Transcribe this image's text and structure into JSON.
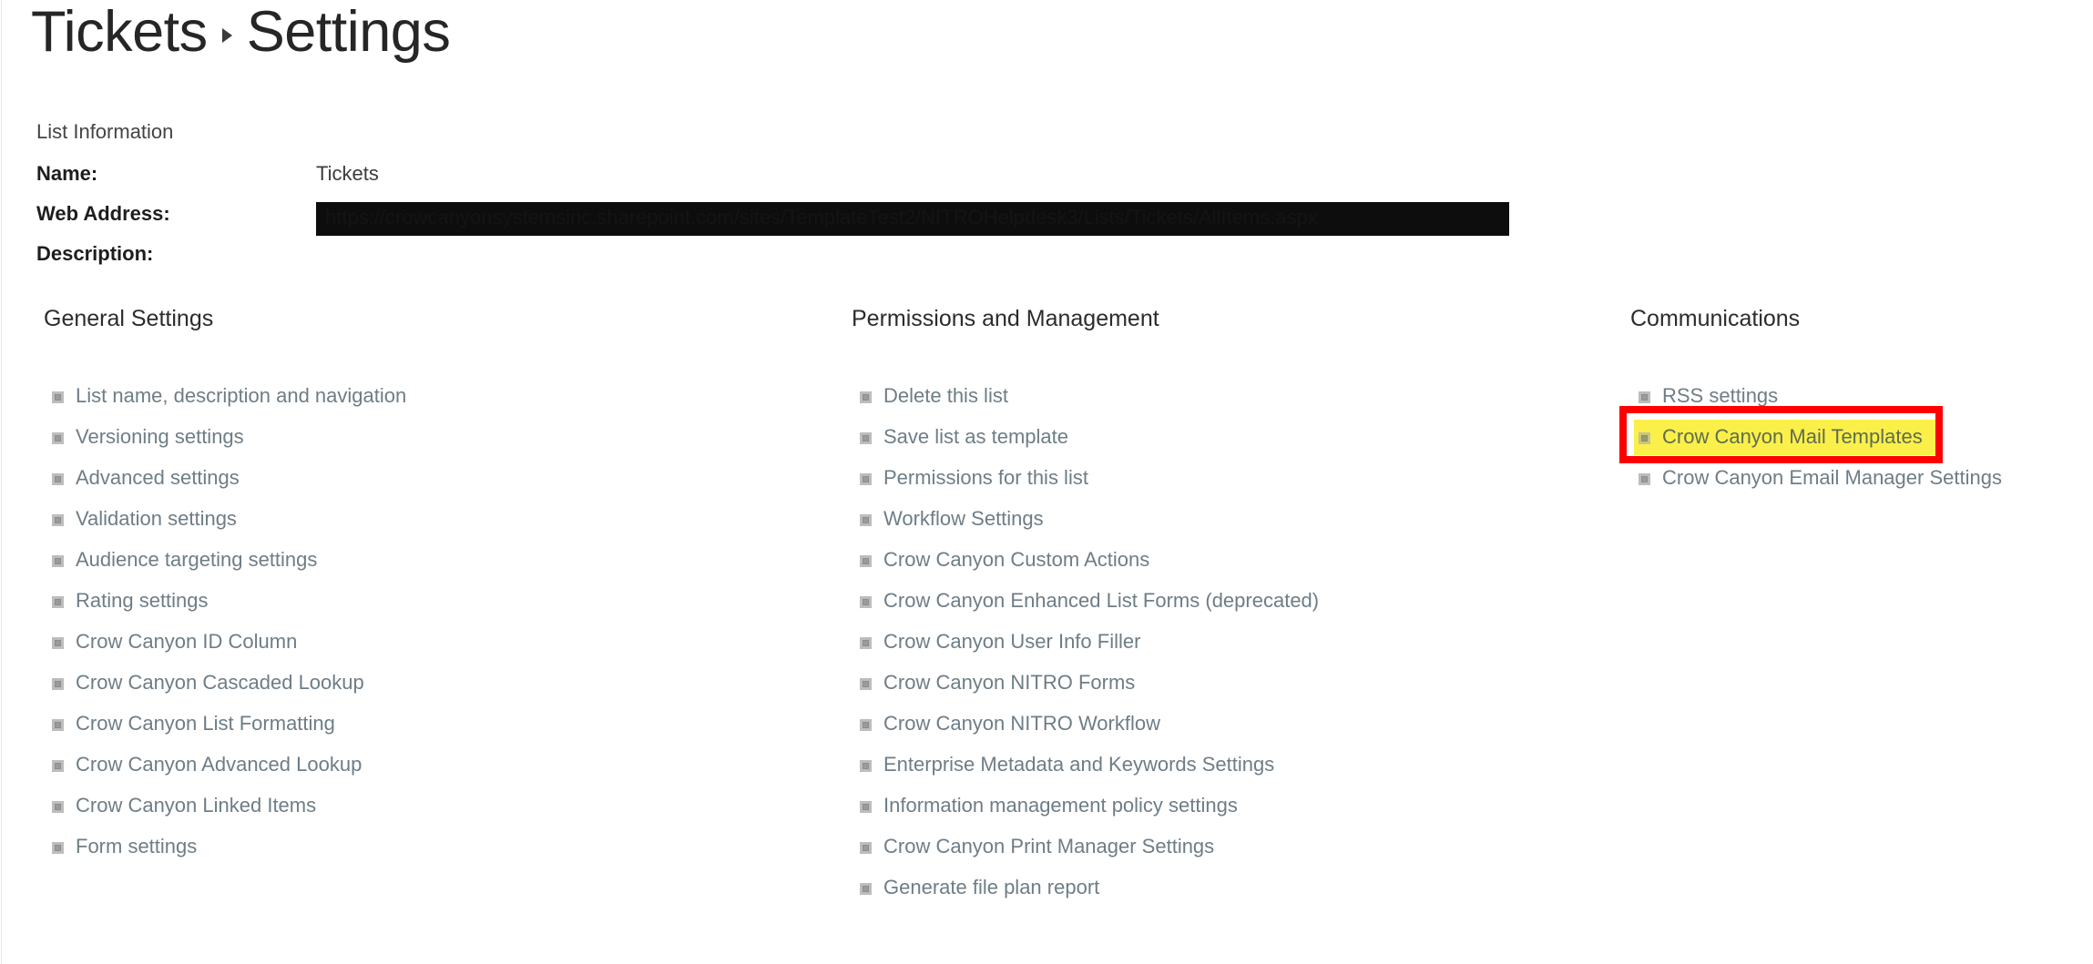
{
  "breadcrumb": {
    "parent": "Tickets",
    "separator_icon": "caret-right-icon",
    "current": "Settings"
  },
  "list_information": {
    "heading": "List Information",
    "fields": [
      {
        "label": "Name:",
        "value": "Tickets"
      },
      {
        "label": "Web Address:",
        "value": "https://crowcanyonsystemsinc.sharepoint.com/sites/TemplateTest2/NITROHelpdesk3/Lists/Tickets/AllItems.aspx"
      },
      {
        "label": "Description:",
        "value": ""
      }
    ]
  },
  "columns": {
    "general": {
      "heading": "General Settings",
      "links": [
        "List name, description and navigation",
        "Versioning settings",
        "Advanced settings",
        "Validation settings",
        "Audience targeting settings",
        "Rating settings",
        "Crow Canyon ID Column",
        "Crow Canyon Cascaded Lookup",
        "Crow Canyon List Formatting",
        "Crow Canyon Advanced Lookup",
        "Crow Canyon Linked Items",
        "Form settings"
      ]
    },
    "permissions": {
      "heading": "Permissions and Management",
      "links": [
        "Delete this list",
        "Save list as template",
        "Permissions for this list",
        "Workflow Settings",
        "Crow Canyon Custom Actions",
        "Crow Canyon Enhanced List Forms (deprecated)",
        "Crow Canyon User Info Filler",
        "Crow Canyon NITRO Forms",
        "Crow Canyon NITRO Workflow",
        "Enterprise Metadata and Keywords Settings",
        "Information management policy settings",
        "Crow Canyon Print Manager Settings",
        "Generate file plan report"
      ]
    },
    "communications": {
      "heading": "Communications",
      "links": [
        "RSS settings",
        "Crow Canyon Mail Templates",
        "Crow Canyon Email Manager Settings"
      ],
      "highlighted_index": 1
    }
  },
  "colors": {
    "link_text": "#6e7d86",
    "heading_text": "#2c2c2c",
    "highlight_background": "#faf049",
    "annotation_border": "#ff0000",
    "redaction_bar": "#0d0d0d"
  }
}
